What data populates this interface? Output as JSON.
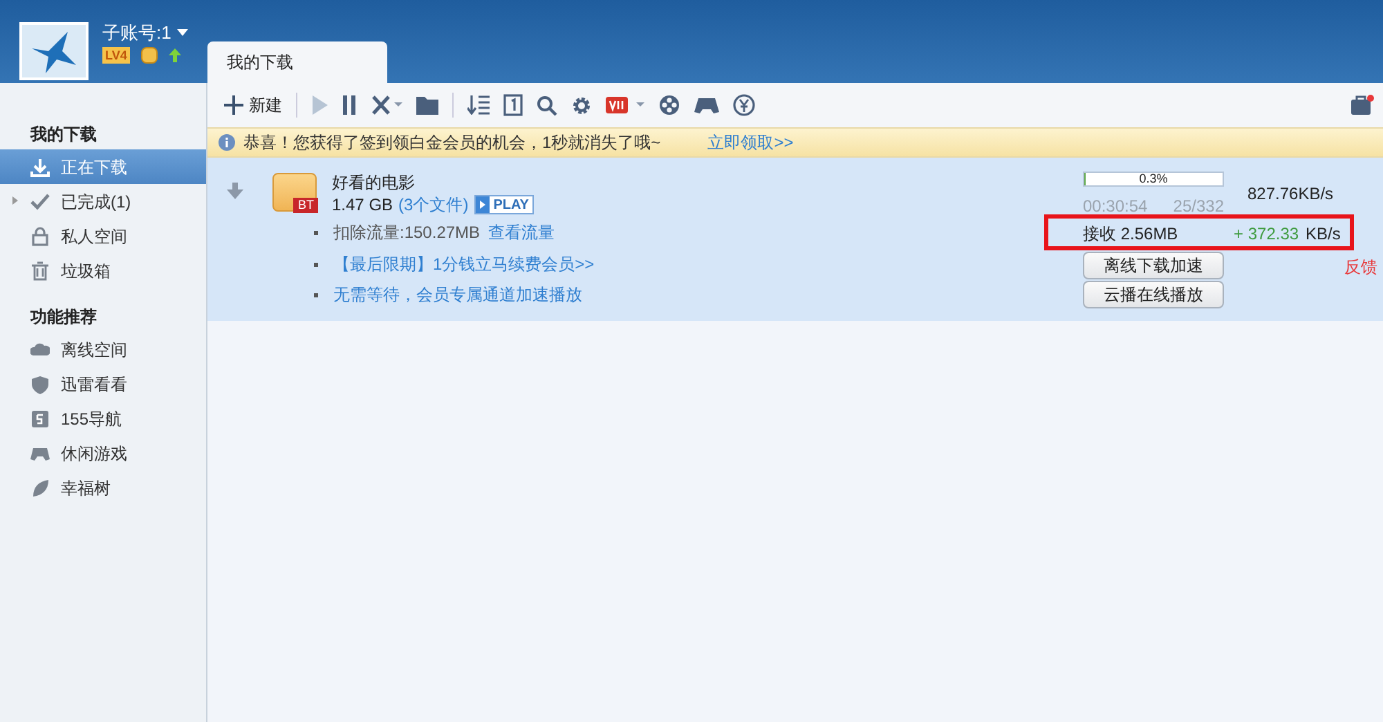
{
  "account": {
    "name": "子账号:1",
    "level_badge": "LV4"
  },
  "tabs": [
    {
      "label": "我的下载",
      "selected": true
    }
  ],
  "sidebar": {
    "sections": [
      {
        "title": "我的下载",
        "items": [
          {
            "label": "正在下载",
            "selected": true
          },
          {
            "label": "已完成(1)",
            "selected": false,
            "expanded": false
          },
          {
            "label": "私人空间",
            "selected": false
          },
          {
            "label": "垃圾箱",
            "selected": false
          }
        ]
      },
      {
        "title": "功能推荐",
        "items": [
          {
            "label": "离线空间",
            "selected": false
          },
          {
            "label": "迅雷看看",
            "selected": false
          },
          {
            "label": "155导航",
            "selected": false
          },
          {
            "label": "休闲游戏",
            "selected": false
          },
          {
            "label": "幸福树",
            "selected": false
          }
        ]
      }
    ]
  },
  "toolbar": {
    "new_label": "新建"
  },
  "notice": {
    "text": "恭喜！您获得了签到领白金会员的机会，1秒就消失了哦~",
    "link": "立即领取>>"
  },
  "task": {
    "name": "好看的电影",
    "size": "1.47 GB",
    "files": "(3个文件)",
    "play": "PLAY",
    "badge": "BT",
    "deduct": "扣除流量:150.27MB",
    "deduct_link": "查看流量",
    "promos": [
      "【最后限期】1分钱立马续费会员>>",
      "无需等待，会员专属通道加速播放"
    ],
    "progress": {
      "level": 0.003,
      "label": "0.3%"
    },
    "elapsed": "00:30:54",
    "pieces": "25/332",
    "speed": "827.76KB/s",
    "received": "接收 2.56MB",
    "boost": "+ 372.33",
    "boost_unit": "KB/s",
    "buttons": [
      "离线下载加速",
      "云播在线播放"
    ],
    "feedback": "反馈"
  }
}
